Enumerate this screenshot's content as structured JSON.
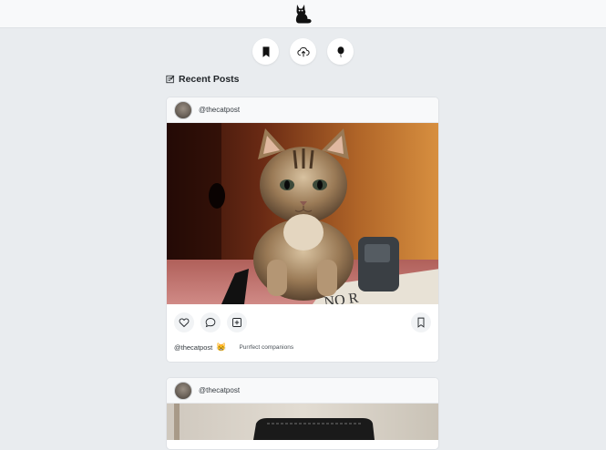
{
  "app": {
    "logo_icon": "cat-logo-icon"
  },
  "nav": {
    "items": [
      {
        "icon": "bookmark-icon"
      },
      {
        "icon": "cloud-upload-icon"
      },
      {
        "icon": "balloon-icon"
      }
    ]
  },
  "feed": {
    "section_title": "Recent Posts",
    "section_icon": "notepad-icon"
  },
  "posts": [
    {
      "username": "@thecatpost",
      "image": "kitten-photo",
      "caption_user": "@thecatpost",
      "caption_emoji": "😸",
      "caption_text": "Purrfect companions",
      "actions": [
        "heart-icon",
        "comment-icon",
        "add-square-icon",
        "bookmark-icon"
      ]
    },
    {
      "username": "@thecatpost",
      "image": "cat-photo-2"
    }
  ],
  "colors": {
    "page_bg": "#e9ecef",
    "topbar_bg": "#f8f9fa",
    "card_bg": "#ffffff"
  }
}
